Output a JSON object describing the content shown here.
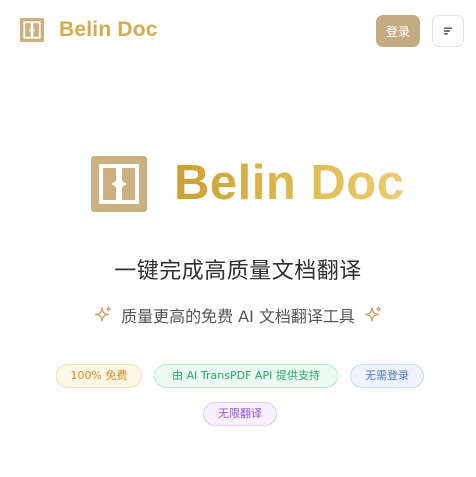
{
  "header": {
    "brand_name": "Belin Doc",
    "logo_icon": "belin-doc-logo-icon",
    "login_label": "登录",
    "menu_icon": "menu-icon"
  },
  "hero": {
    "title": "Belin Doc",
    "headline": "一键完成高质量文档翻译",
    "subline": "质量更高的免费 AI 文档翻译工具",
    "sparkle_icon": "sparkle-icon"
  },
  "badges": [
    {
      "label": "100% 免费"
    },
    {
      "label": "由 AI TransPDF API 提供支持"
    },
    {
      "label": "无需登录"
    },
    {
      "label": "无限翻译"
    }
  ],
  "colors": {
    "brand_gold": "#d2ad4a",
    "logo_tan": "#cdb080",
    "login_button": "#c5ab84"
  }
}
